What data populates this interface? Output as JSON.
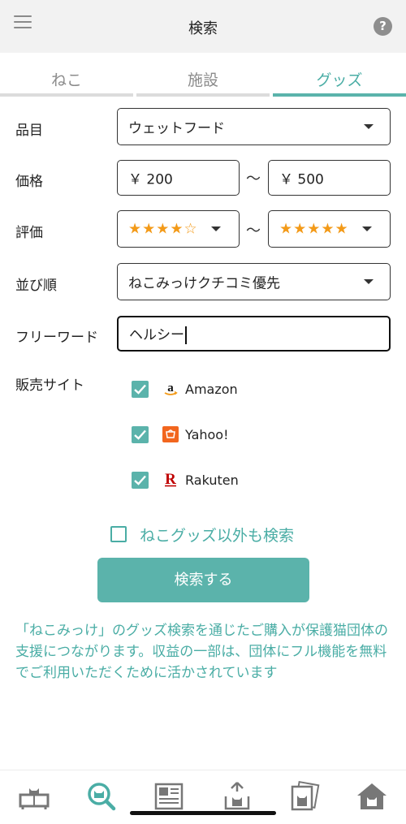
{
  "header": {
    "title": "検索",
    "menu_icon": "hamburger-menu-icon",
    "help_label": "?"
  },
  "tabs": [
    {
      "label": "ねこ",
      "active": false
    },
    {
      "label": "施設",
      "active": false
    },
    {
      "label": "グッズ",
      "active": true
    }
  ],
  "form": {
    "item": {
      "label": "品目",
      "value": "ウェットフード"
    },
    "price": {
      "label": "価格",
      "min": "￥ 200",
      "separator": "〜",
      "max": "￥ 500"
    },
    "rating": {
      "label": "評価",
      "min": "★★★★☆",
      "separator": "〜",
      "max": "★★★★★"
    },
    "sort": {
      "label": "並び順",
      "value": "ねこみっけクチコミ優先"
    },
    "freeword": {
      "label": "フリーワード",
      "value": "ヘルシー"
    },
    "sites": {
      "label": "販売サイト",
      "items": [
        {
          "name": "Amazon",
          "checked": true,
          "icon": "amazon-logo-icon"
        },
        {
          "name": "Yahoo!",
          "checked": true,
          "icon": "yahoo-shopping-logo-icon"
        },
        {
          "name": "Rakuten",
          "checked": true,
          "icon": "rakuten-logo-icon"
        }
      ]
    },
    "also_search": {
      "label": "ねこグッズ以外も検索",
      "checked": false
    },
    "submit_label": "検索する"
  },
  "note": "「ねこみっけ」のグッズ検索を通じたご購入が保護猫団体の支援につながります。収益の一部は、団体にフル機能を無料でご利用いただくために活かされています",
  "colors": {
    "accent": "#5bb3ab",
    "accent_text": "#4aada5",
    "star": "#f39a18",
    "header_bg": "#f2f2f2"
  },
  "bottom_nav": [
    {
      "icon": "cat-board-icon"
    },
    {
      "icon": "search-cat-icon",
      "active": true
    },
    {
      "icon": "newspaper-icon"
    },
    {
      "icon": "upload-cat-icon"
    },
    {
      "icon": "cat-photos-icon"
    },
    {
      "icon": "home-cat-icon"
    }
  ]
}
